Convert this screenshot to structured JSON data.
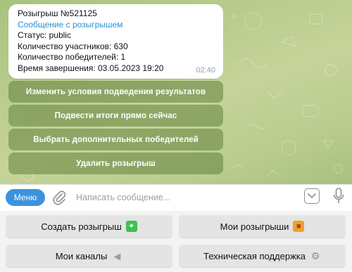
{
  "message": {
    "title": "Розыгрыш №521125",
    "link_text": "Сообщение с розыгрышем",
    "status": "Статус: public",
    "participants": "Количество участников: 630",
    "winners": "Количество победителей: 1",
    "end_time": "Время завершения: 03.05.2023 19:20",
    "time": "02:40"
  },
  "inline_buttons": [
    "Изменить условия подведения результатов",
    "Подвести итоги прямо сейчас",
    "Выбрать дополнительных победителей",
    "Удалить розыгрыш"
  ],
  "input_bar": {
    "menu_label": "Меню",
    "placeholder": "Написать сообщение..."
  },
  "reply_keyboard": [
    {
      "label": "Создать розыгрыш",
      "icon": "sparkles-icon"
    },
    {
      "label": "Мои розыгрыши",
      "icon": "gift-icon"
    },
    {
      "label": "Мои каналы",
      "icon": "megaphone-icon"
    },
    {
      "label": "Техническая поддержка",
      "icon": "gear-icon"
    }
  ],
  "colors": {
    "menu_button": "#3b92de",
    "link": "#2a8fd6",
    "inline_button": "#60823c"
  }
}
